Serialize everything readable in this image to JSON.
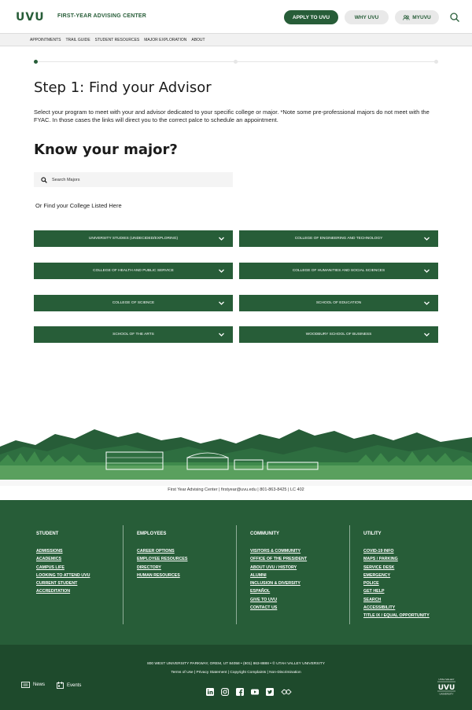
{
  "header": {
    "logo_text": "UVU",
    "site_name": "FIRST-YEAR ADVISING CENTER",
    "apply_label": "APPLY TO UVU",
    "why_label": "WHY UVU",
    "my_label": "MYUVU"
  },
  "subnav": [
    "APPOINTMENTS",
    "TRAIL GUIDE",
    "STUDENT RESOURCES",
    "MAJOR EXPLORATION",
    "ABOUT"
  ],
  "main": {
    "step_title": "Step 1: Find your Advisor",
    "step_desc": "Select your program to meet with your and advisor dedicated to your specific college or major. *Note some pre-professional majors do not meet with the FYAC. In those cases the links will direct you to the correct palce to schedule an appointment.",
    "know_title": "Know your major?",
    "search_placeholder": "Search Majors",
    "or_find": "Or Find your College Listed Here",
    "colleges": [
      "UNIVERSITY STUDIES (UNDECIDED/EXPLORING)",
      "COLLEGE OF ENGINEERING AND TECHNOLOGY",
      "COLLEGE OF HEALTH AND PUBLIC SERVICE",
      "COLLEGE OF HUMANITIES AND SOCIAL SCIENCES",
      "COLLEGE OF SCIENCE",
      "SCHOOL OF EDUCATION",
      "SCHOOL OF THE ARTS",
      "WOODBURY SCHOOL OF BUSINESS"
    ]
  },
  "contact_line": "First Year Advising Center  |  firstyear@uvu.edu  |  801-863-8425  |  LC 402",
  "footer": {
    "student": {
      "heading": "STUDENT",
      "links": [
        "ADMISSIONS",
        "ACADEMICS",
        "CAMPUS LIFE",
        "LOOKING TO ATTEND UVU",
        "CURRENT STUDENT",
        "ACCREDITATION"
      ]
    },
    "employees": {
      "heading": "EMPLOYEES",
      "links": [
        "CAREER OPTIONS",
        "EMPLOYEE RESOURCES",
        "DIRECTORY",
        "HUMAN RESOURCES"
      ]
    },
    "community": {
      "heading": "COMMUNITY",
      "links": [
        "VISITORS & COMMUNITY",
        "OFFICE OF THE PRESIDENT",
        "ABOUT UVU / HISTORY",
        "ALUMNI",
        "INCLUSION & DIVERSITY",
        "ESPAÑOL",
        "GIVE TO UVU",
        "CONTACT US"
      ]
    },
    "utility": {
      "heading": "UTILITY",
      "links": [
        "COVID-19 INFO",
        "MAPS / PARKING",
        "SERVICE DESK",
        "EMERGENCY",
        "POLICE",
        "GET HELP",
        "SEARCH",
        "ACCESSIBILITY",
        "TITLE IX / EQUAL OPPORTUNITY"
      ]
    },
    "address": "800 WEST UNIVERSITY PARKWAY, OREM, UT 84058 • (801) 863-8888 • © UTAH VALLEY UNIVERSITY",
    "legal": "Terms of Use  |  Privacy Statement  |  Copyright Complaints  |  Non-Discrimination",
    "news_label": "News",
    "events_label": "Events",
    "social": [
      "linkedin-icon",
      "instagram-icon",
      "facebook-icon",
      "youtube-icon",
      "twitter-icon",
      "wolverine-icon"
    ],
    "small_logo_top": "UTAH VALLEY",
    "small_logo_text": "UVU",
    "small_logo_bottom": "UNIVERSITY"
  },
  "colors": {
    "brand_green": "#275d38",
    "footer_dark": "#1e4a2c"
  }
}
